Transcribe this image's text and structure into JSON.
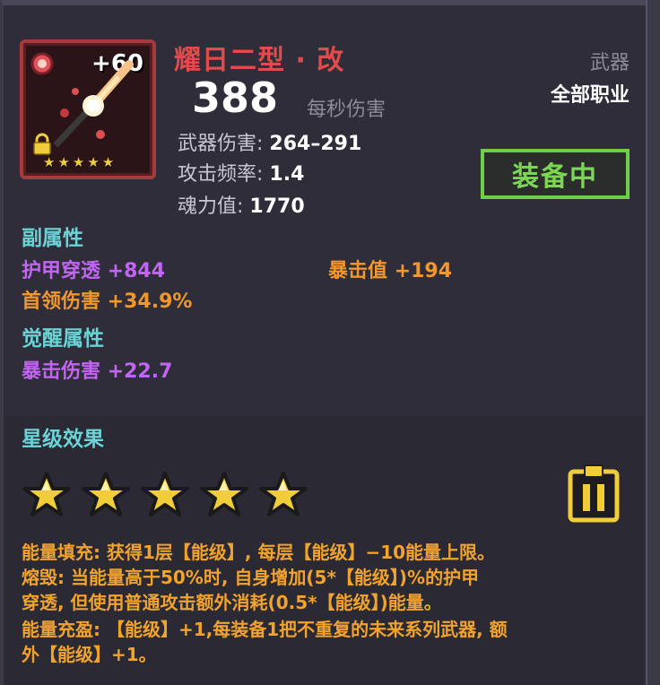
{
  "item": {
    "name": "耀日二型 · 改",
    "plus_level": "+60",
    "dps": "388",
    "dps_label": "每秒伤害",
    "type": "武器",
    "class": "全部职业",
    "equip_status": "装备中",
    "stars": 5
  },
  "stats": {
    "damage_label": "武器伤害:",
    "damage_value": "264–291",
    "rate_label": "攻击频率:",
    "rate_value": "1.4",
    "soul_label": "魂力值:",
    "soul_value": "1770"
  },
  "secondary": {
    "title": "副属性",
    "items": [
      {
        "label": "护甲穿透",
        "value": "+844",
        "color": "#c265f2"
      },
      {
        "label": "暴击值",
        "value": "+194",
        "color": "#f2972b"
      },
      {
        "label": "首领伤害",
        "value": "+34.9%",
        "color": "#f2972b"
      }
    ]
  },
  "awaken": {
    "title": "觉醒属性",
    "items": [
      {
        "label": "暴击伤害",
        "value": "+22.7",
        "color": "#c265f2"
      }
    ]
  },
  "star_effect": {
    "title": "星级效果",
    "lines": [
      {
        "head": "能量填充:",
        "body": "获得1层【能级】, 每层【能级】−10能量上限。"
      },
      {
        "head": "熔毁:",
        "body": "当能量高于50%时, 自身增加(5*【能级】)%的护甲"
      },
      {
        "head": "",
        "body": "穿透, 但使用普通攻击额外消耗(0.5*【能级】)能量。"
      },
      {
        "head": "能量充盈:",
        "body": "【能级】+1,每装备1把不重复的未来系列武器, 额"
      },
      {
        "head": "",
        "body": "外【能级】+1。"
      }
    ]
  },
  "colors": {
    "name": "#e04b4b",
    "equip": "#7bd654",
    "section": "#6ad3d6",
    "description": "#f2a32c",
    "star": "#f2cd3a"
  },
  "icons": {
    "gem": "red-gem-icon",
    "lock": "gold-lock-icon",
    "weapon": "sun-staff-icon",
    "clipboard": "clipboard-icon"
  }
}
